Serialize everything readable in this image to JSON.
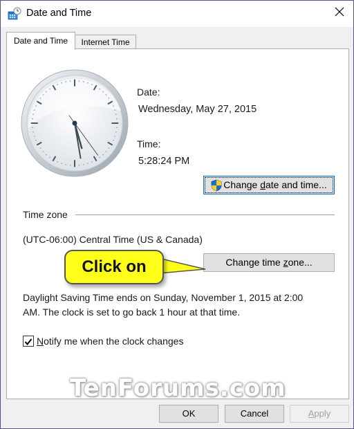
{
  "window": {
    "title": "Date and Time",
    "icon": "date-time-icon",
    "close_icon": "close-icon"
  },
  "tabs": [
    {
      "label": "Date and Time",
      "active": true
    },
    {
      "label": "Internet Time",
      "active": false
    }
  ],
  "clock": {
    "hour": 5,
    "minute": 28,
    "second": 24
  },
  "date_section": {
    "date_label": "Date:",
    "date_value": "Wednesday, May 27, 2015",
    "time_label": "Time:",
    "time_value": "5:28:24 PM",
    "change_button": {
      "pre": "Change ",
      "accel": "d",
      "post": "ate and time...",
      "icon": "uac-shield-icon"
    }
  },
  "timezone_section": {
    "heading": "Time zone",
    "value": "(UTC-06:00) Central Time (US & Canada)",
    "change_button": {
      "pre": "Change time ",
      "accel": "z",
      "post": "one..."
    }
  },
  "callout": {
    "text": "Click on",
    "color": "#ffff1a"
  },
  "dst": {
    "line1": "Daylight Saving Time ends on Sunday, November 1, 2015 at 2:00",
    "line2": "AM. The clock is set to go back 1 hour at that time."
  },
  "notify": {
    "checked": true,
    "accel": "N",
    "rest": "otify me when the clock changes"
  },
  "watermark": "TenForums.com",
  "footer": {
    "ok": "OK",
    "cancel": "Cancel",
    "apply_accel": "A",
    "apply_rest": "pply",
    "apply_enabled": false
  }
}
